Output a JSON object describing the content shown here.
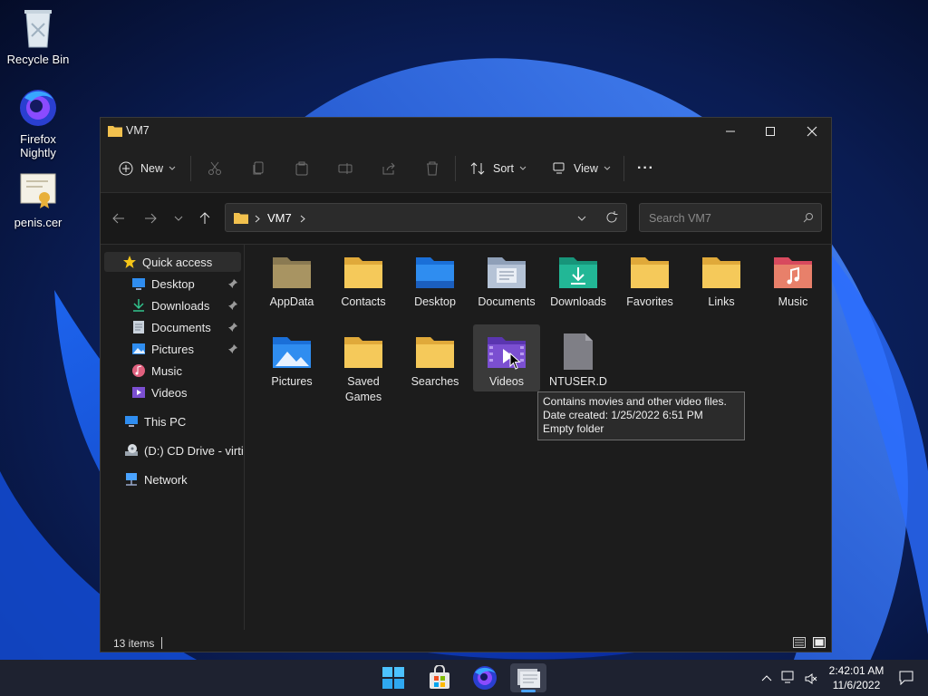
{
  "desktop": {
    "icons": [
      {
        "label": "Recycle Bin"
      },
      {
        "label": "Firefox Nightly"
      },
      {
        "label": "penis.cer"
      }
    ]
  },
  "window": {
    "title": "VM7",
    "commands": {
      "new": "New",
      "sort": "Sort",
      "view": "View",
      "more": "···"
    },
    "breadcrumb": [
      "VM7"
    ],
    "search_placeholder": "Search VM7",
    "sidebar": {
      "quick_access": "Quick access",
      "items": [
        {
          "label": "Desktop",
          "pinned": true,
          "icon": "desktop-icon"
        },
        {
          "label": "Downloads",
          "pinned": true,
          "icon": "download-icon"
        },
        {
          "label": "Documents",
          "pinned": true,
          "icon": "document-icon"
        },
        {
          "label": "Pictures",
          "pinned": true,
          "icon": "pictures-icon"
        },
        {
          "label": "Music",
          "pinned": false,
          "icon": "music-icon"
        },
        {
          "label": "Videos",
          "pinned": false,
          "icon": "videos-icon"
        }
      ],
      "this_pc": "This PC",
      "cd_drive": "(D:) CD Drive - virtio",
      "network": "Network"
    },
    "items": [
      {
        "label": "AppData",
        "icon": "folder-dim"
      },
      {
        "label": "Contacts",
        "icon": "folder"
      },
      {
        "label": "Desktop",
        "icon": "folder-desktop"
      },
      {
        "label": "Documents",
        "icon": "folder-documents"
      },
      {
        "label": "Downloads",
        "icon": "folder-downloads"
      },
      {
        "label": "Favorites",
        "icon": "folder"
      },
      {
        "label": "Links",
        "icon": "folder"
      },
      {
        "label": "Music",
        "icon": "folder-music"
      },
      {
        "label": "Pictures",
        "icon": "folder-pictures"
      },
      {
        "label": "Saved Games",
        "icon": "folder"
      },
      {
        "label": "Searches",
        "icon": "folder"
      },
      {
        "label": "Videos",
        "icon": "folder-videos"
      },
      {
        "label": "NTUSER.D",
        "icon": "file"
      }
    ],
    "tooltip": {
      "line1": "Contains movies and other video files.",
      "line2": "Date created: 1/25/2022 6:51 PM",
      "line3": "Empty folder"
    },
    "status": {
      "count": "13 items"
    }
  },
  "taskbar": {
    "time": "2:42:01 AM",
    "date": "11/6/2022"
  },
  "colors": {
    "accent": "#4aa3ff",
    "folder": "#f2c14e",
    "videos": "#7b4fd1"
  }
}
